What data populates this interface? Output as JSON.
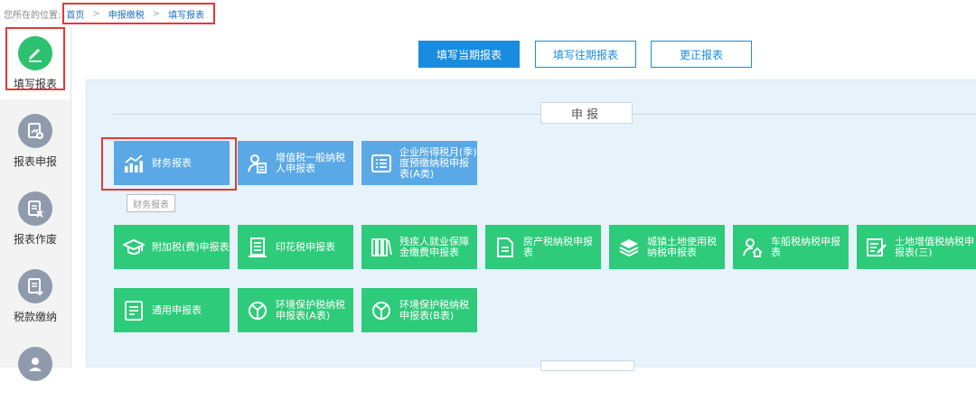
{
  "breadcrumb": {
    "prefix": "您所在的位置:",
    "items": [
      "首页",
      "申报缴税",
      "填写报表"
    ],
    "separator": ">"
  },
  "sidebar": {
    "items": [
      {
        "label": "填写报表",
        "icon": "pencil-icon",
        "active": true
      },
      {
        "label": "报表申报",
        "icon": "report-upload-icon"
      },
      {
        "label": "报表作废",
        "icon": "report-void-icon"
      },
      {
        "label": "税款缴纳",
        "icon": "tax-payment-icon"
      },
      {
        "label": "",
        "icon": "user-icon"
      }
    ]
  },
  "tabs": [
    "填写当期报表",
    "填写往期报表",
    "更正报表"
  ],
  "section": {
    "title": "申报"
  },
  "tiles": [
    {
      "label": "财务报表",
      "icon": "bar-chart-icon",
      "color": "#5aa9e6"
    },
    {
      "label": "增值税一般纳税人申报表",
      "icon": "person-document-icon",
      "color": "#5aa9e6"
    },
    {
      "label": "企业所得税月(季)度预缴纳税申报表(A类)",
      "icon": "list-icon",
      "color": "#5aa9e6"
    },
    {
      "label": "附加税(费)申报表",
      "icon": "graduation-cap-icon",
      "color": "#2ecb7a"
    },
    {
      "label": "印花税申报表",
      "icon": "document-lines-icon",
      "color": "#2ecb7a"
    },
    {
      "label": "残疾人就业保障金缴费申报表",
      "icon": "books-icon",
      "color": "#2ecb7a"
    },
    {
      "label": "房产税纳税申报表",
      "icon": "document-icon",
      "color": "#2ecb7a"
    },
    {
      "label": "城镇土地使用税纳税申报表",
      "icon": "layers-icon",
      "color": "#2ecb7a"
    },
    {
      "label": "车船税纳税申报表",
      "icon": "person-home-icon",
      "color": "#2ecb7a"
    },
    {
      "label": "土地增值税纳税申报表(三)",
      "icon": "edit-document-icon",
      "color": "#2ecb7a"
    },
    {
      "label": "通用申报表",
      "icon": "document-lines-icon",
      "color": "#2ecb7a"
    },
    {
      "label": "环境保护税纳税申报表(A表)",
      "icon": "shield-leaf-icon",
      "color": "#2ecb7a"
    },
    {
      "label": "环境保护税纳税申报表(B表)",
      "icon": "shield-leaf-icon",
      "color": "#2ecb7a"
    }
  ],
  "tooltip": "财务报表",
  "colors": {
    "accent": "#1a8ce0",
    "active_green": "#2ec16f",
    "highlight": "#e03a3a"
  }
}
